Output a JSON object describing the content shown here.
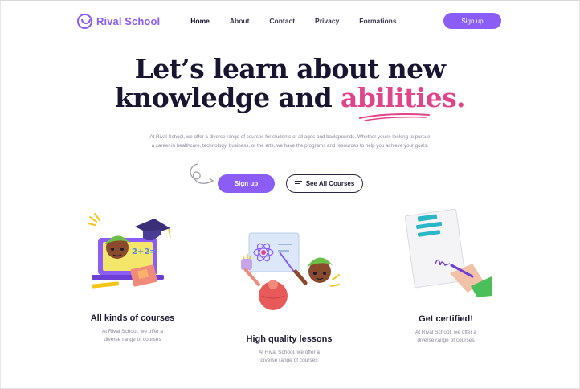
{
  "brand": {
    "name": "Rival School",
    "color": "#8b5cf6",
    "accent": "#e0448a"
  },
  "nav": {
    "items": [
      {
        "label": "Home",
        "active": true
      },
      {
        "label": "About",
        "active": false
      },
      {
        "label": "Contact",
        "active": false
      },
      {
        "label": "Privacy",
        "active": false
      },
      {
        "label": "Formations",
        "active": false
      }
    ],
    "signup_label": "Sign up"
  },
  "hero": {
    "title_line1": "Let’s learn about new",
    "title_line2_start": "knowledge and ",
    "title_line2_accent": "abilities.",
    "description": "At Rival School, we offer a diverse range of courses for students of all ages and backgrounds. Whether you're looking to pursue a career in healthcare, technology, business, or the arts, we have the programs and resources to help you achieve your goals.",
    "primary_cta": "Sign up",
    "secondary_cta": "See All Courses"
  },
  "features": [
    {
      "title": "All kinds of courses",
      "text": "At Rival School, we offer a diverse range of courses",
      "icon": "laptop-student-icon"
    },
    {
      "title": "High quality lessons",
      "text": "At Rival School, we offer a diverse range of courses",
      "icon": "teacher-board-icon"
    },
    {
      "title": "Get certified!",
      "text": "At Rival School, we offer a diverse range of courses",
      "icon": "certificate-signing-icon"
    }
  ]
}
